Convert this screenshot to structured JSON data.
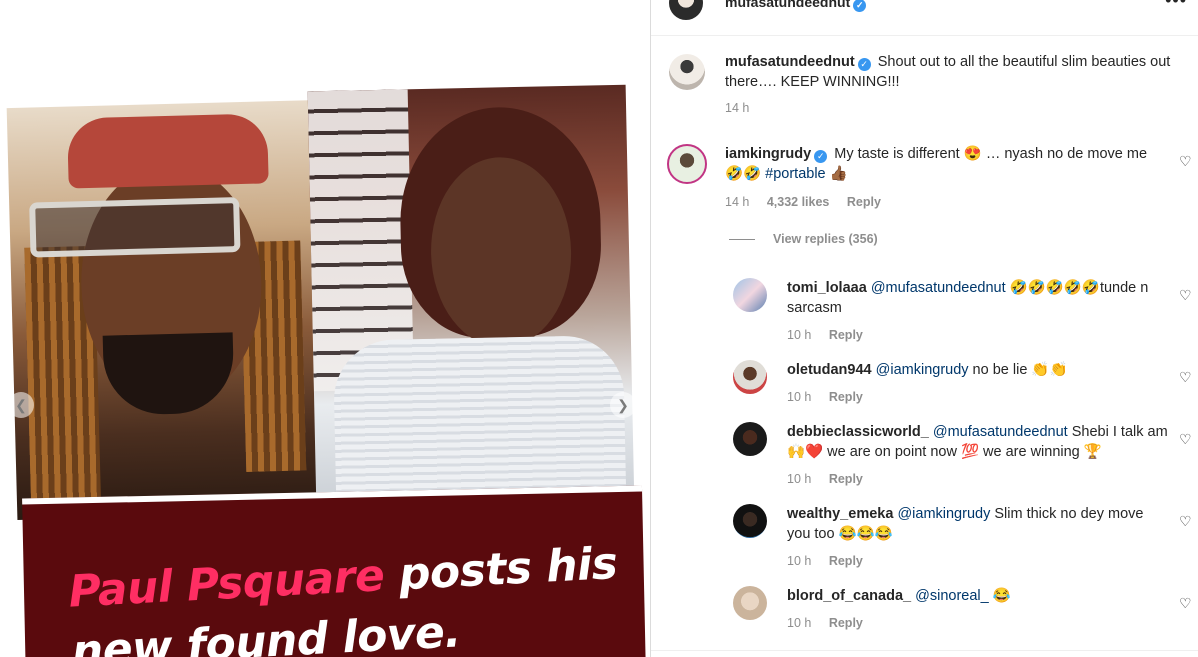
{
  "post": {
    "headline_pink": "Paul Psquare",
    "headline_rest_line1": " posts his",
    "headline_line2": "new found love."
  },
  "header": {
    "username": "mufasatundeednut",
    "more_icon": "more-icon"
  },
  "caption": {
    "username": "mufasatundeednut",
    "text": "Shout out to all the beautiful slim beauties out there…. KEEP WINNING!!!",
    "time": "14 h"
  },
  "top_comment": {
    "username": "iamkingrudy",
    "text_before_tag": "My taste is different 😍 … nyash no de move me 🤣🤣 ",
    "hashtag": "#portable",
    "text_after_tag": " 👍🏾",
    "time": "14 h",
    "likes": "4,332 likes",
    "reply_label": "Reply"
  },
  "view_replies_label": "View replies (356)",
  "replies": [
    {
      "username": "tomi_lolaaa",
      "mention": "@mufasatundeednut",
      "text": " 🤣🤣🤣🤣🤣tunde n sarcasm",
      "time": "10 h",
      "reply_label": "Reply"
    },
    {
      "username": "oletudan944",
      "mention": "@iamkingrudy",
      "text": " no be lie 👏👏",
      "time": "10 h",
      "reply_label": "Reply"
    },
    {
      "username": "debbieclassicworld_",
      "mention": "@mufasatundeednut",
      "text": " Shebi I talk am 🙌❤️ we are on point now 💯 we are winning 🏆",
      "time": "10 h",
      "reply_label": "Reply"
    },
    {
      "username": "wealthy_emeka",
      "mention": "@iamkingrudy",
      "text": " Slim thick no dey move you too 😂😂😂",
      "time": "10 h",
      "reply_label": "Reply"
    },
    {
      "username": "blord_of_canada_",
      "mention": "@sinoreal_",
      "text": " 😂",
      "time": "10 h",
      "reply_label": "Reply"
    }
  ],
  "colors": {
    "mention": "#00376b",
    "meta": "#8e8e8e",
    "verified": "#3897f0",
    "headline_pink": "#ff2e63",
    "headline_bg": "#5a0a0d"
  }
}
